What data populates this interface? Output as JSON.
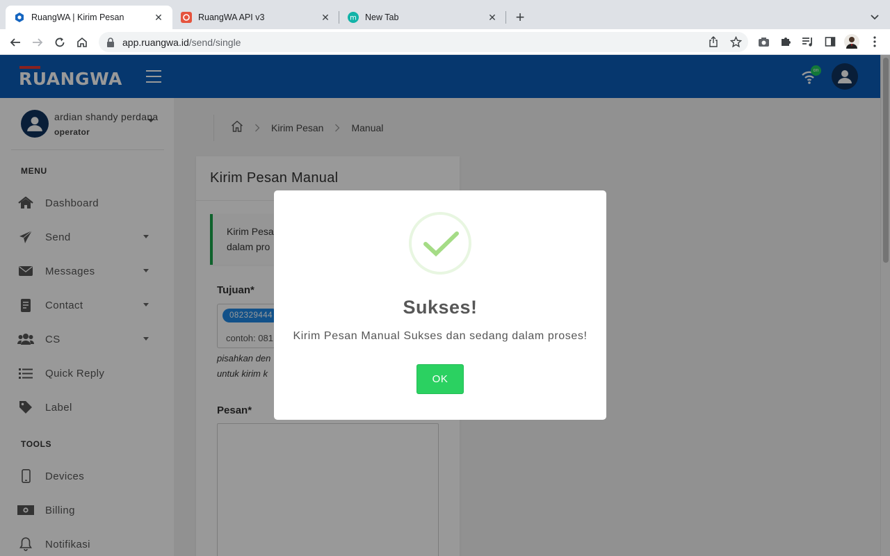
{
  "browser": {
    "tabs": [
      {
        "title": "RuangWA | Kirim Pesan",
        "favicon": "ruangwa-hex-icon",
        "active": true
      },
      {
        "title": "RuangWA API v3",
        "favicon": "api-orange-icon",
        "active": false
      },
      {
        "title": "New Tab",
        "favicon": "teal-m-icon",
        "active": false
      }
    ],
    "url_host": "app.ruangwa.id",
    "url_path": "/send/single"
  },
  "app": {
    "logo": "RUANGWA",
    "wifi_badge": "on",
    "user": {
      "name": "ardian shandy perdana",
      "role": "operator"
    },
    "sections": {
      "menu": "MENU",
      "tools": "TOOLS"
    },
    "menu": [
      {
        "label": "Dashboard",
        "icon": "home-icon",
        "has_caret": false
      },
      {
        "label": "Send",
        "icon": "paper-plane-icon",
        "has_caret": true
      },
      {
        "label": "Messages",
        "icon": "envelope-icon",
        "has_caret": true
      },
      {
        "label": "Contact",
        "icon": "address-book-icon",
        "has_caret": true
      },
      {
        "label": "CS",
        "icon": "users-icon",
        "has_caret": true
      },
      {
        "label": "Quick Reply",
        "icon": "list-icon",
        "has_caret": false
      },
      {
        "label": "Label",
        "icon": "tag-icon",
        "has_caret": false
      }
    ],
    "tools": [
      {
        "label": "Devices",
        "icon": "mobile-icon"
      },
      {
        "label": "Billing",
        "icon": "money-bill-icon"
      },
      {
        "label": "Notifikasi",
        "icon": "bell-icon"
      }
    ],
    "breadcrumb": [
      "Kirim Pesan",
      "Manual"
    ]
  },
  "form": {
    "title": "Kirim Pesan Manual",
    "alert_line1": "Kirim Pesa",
    "alert_line2": "dalam pro",
    "tujuan_label": "Tujuan*",
    "chip_value": "082329444",
    "tujuan_placeholder": "contoh: 081",
    "hint_line1": "pisahkan den",
    "hint_line2": "untuk kirim k",
    "pesan_label": "Pesan*"
  },
  "modal": {
    "icon": "success-check-icon",
    "title": "Sukses!",
    "message": "Kirim Pesan Manual Sukses dan sedang dalam proses!",
    "ok_label": "OK"
  },
  "colors": {
    "navbar": "#0b5cb8",
    "ok_button": "#2bd161",
    "success_check": "#a5dc86",
    "alert_border": "#1aa34a",
    "chip": "#1e88e5"
  }
}
